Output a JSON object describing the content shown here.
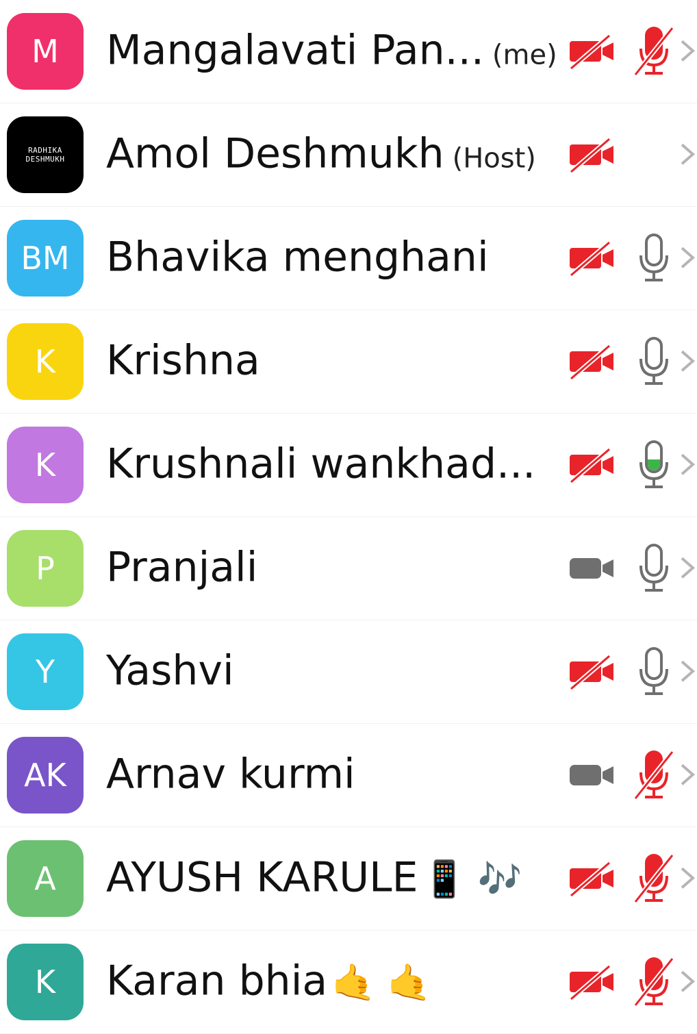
{
  "participants": [
    {
      "initials": "M",
      "color": "#f0306a",
      "name": "Mangalavati Pan...",
      "tag": "(me)",
      "emoji": "",
      "video": "off",
      "mic": "muted"
    },
    {
      "initials": "RADHIKA\nDESHMUKH",
      "color": "#000000",
      "name": "Amol Deshmukh",
      "tag": "(Host)",
      "emoji": "",
      "video": "off",
      "mic": "none"
    },
    {
      "initials": "BM",
      "color": "#35b6ee",
      "name": "Bhavika menghani",
      "tag": "",
      "emoji": "",
      "video": "off",
      "mic": "on"
    },
    {
      "initials": "K",
      "color": "#f9d50f",
      "name": "Krishna",
      "tag": "",
      "emoji": "",
      "video": "off",
      "mic": "on"
    },
    {
      "initials": "K",
      "color": "#c178e0",
      "name": "Krushnali  wankhad...",
      "tag": "",
      "emoji": "",
      "video": "off",
      "mic": "speaking"
    },
    {
      "initials": "P",
      "color": "#a8de6a",
      "name": "Pranjali",
      "tag": "",
      "emoji": "",
      "video": "on",
      "mic": "on"
    },
    {
      "initials": "Y",
      "color": "#34c6e4",
      "name": "Yashvi",
      "tag": "",
      "emoji": "",
      "video": "off",
      "mic": "on"
    },
    {
      "initials": "AK",
      "color": "#7a55c9",
      "name": "Arnav kurmi",
      "tag": "",
      "emoji": "",
      "video": "on",
      "mic": "muted"
    },
    {
      "initials": "A",
      "color": "#6cc072",
      "name": "AYUSH KARULE",
      "tag": "",
      "emoji": "📱 🎶",
      "video": "off",
      "mic": "muted"
    },
    {
      "initials": "K",
      "color": "#2fa897",
      "name": "Karan bhia",
      "tag": "",
      "emoji": "🤙 🤙",
      "video": "off",
      "mic": "muted"
    }
  ],
  "colors": {
    "muted": "#e8242a",
    "speaking": "#3bb54a",
    "neutral": "#6f6f6f",
    "chevron": "#b5b5b5"
  },
  "icons": {
    "video-off": "video-off-icon",
    "video-on": "video-icon",
    "mic-muted": "mic-muted-icon",
    "mic-on": "mic-icon",
    "chevron": "chevron-right-icon"
  }
}
